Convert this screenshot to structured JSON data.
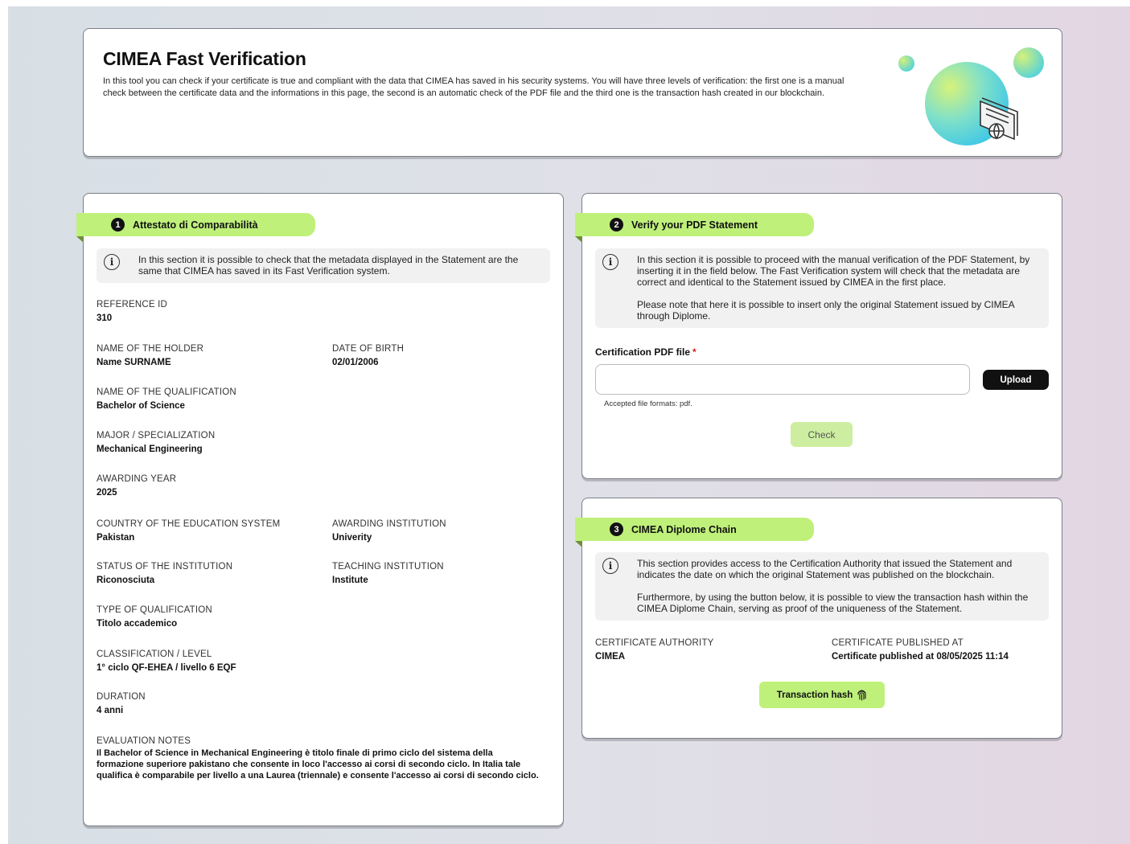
{
  "header": {
    "title": "CIMEA Fast Verification",
    "description": "In this tool you can check if your certificate is true and compliant with the data that CIMEA has saved in his security systems. You will have three levels of verification: the first one is a manual check between the certificate data and the informations in this page, the second is an automatic check of the PDF file and the third one is the transaction hash created in our blockchain."
  },
  "section1": {
    "number": "1",
    "title": "Attestato di Comparabilità",
    "info": "In this section it is possible to check that the metadata displayed in the Statement are the same that CIMEA has saved in its Fast Verification system.",
    "fields": {
      "reference_id": {
        "label": "REFERENCE ID",
        "value": "310"
      },
      "holder": {
        "label": "NAME OF THE HOLDER",
        "value": "Name SURNAME"
      },
      "dob": {
        "label": "DATE OF BIRTH",
        "value": "02/01/2006"
      },
      "qualification": {
        "label": "NAME OF THE QUALIFICATION",
        "value": "Bachelor of Science"
      },
      "major": {
        "label": "MAJOR / SPECIALIZATION",
        "value": "Mechanical Engineering"
      },
      "year": {
        "label": "AWARDING YEAR",
        "value": "2025"
      },
      "country": {
        "label": "COUNTRY OF THE EDUCATION SYSTEM",
        "value": "Pakistan"
      },
      "awarding": {
        "label": "AWARDING INSTITUTION",
        "value": "Univerity"
      },
      "status": {
        "label": "STATUS OF THE INSTITUTION",
        "value": "Riconosciuta"
      },
      "teaching": {
        "label": "TEACHING INSTITUTION",
        "value": "Institute"
      },
      "type": {
        "label": "TYPE OF QUALIFICATION",
        "value": "Titolo accademico"
      },
      "classification": {
        "label": "CLASSIFICATION / LEVEL",
        "value": "1° ciclo QF-EHEA / livello 6 EQF"
      },
      "duration": {
        "label": "DURATION",
        "value": "4 anni"
      },
      "notes": {
        "label": "EVALUATION NOTES",
        "value": "Il Bachelor of Science in Mechanical Engineering è titolo finale di primo ciclo del sistema della formazione superiore pakistano che consente in loco l'accesso ai corsi di secondo ciclo. In Italia tale qualifica è comparabile per livello a una Laurea (triennale) e consente l'accesso ai corsi di secondo ciclo."
      }
    }
  },
  "section2": {
    "number": "2",
    "title": "Verify your PDF Statement",
    "info_p1": "In this section it is possible to proceed with the manual verification of the PDF Statement, by inserting it in the field below. The Fast Verification system will check that the metadata are correct and identical to the Statement issued by CIMEA in the first place.",
    "info_p2": "Please note that here it is possible to insert only the original Statement issued by CIMEA through Diplome.",
    "file_label": "Certification PDF file",
    "required_mark": "*",
    "upload_label": "Upload",
    "formats": "Accepted file formats: pdf.",
    "check_label": "Check"
  },
  "section3": {
    "number": "3",
    "title": "CIMEA Diplome Chain",
    "info_p1": "This section provides access to the Certification Authority that issued the Statement and indicates the date on which the original Statement was published on the blockchain.",
    "info_p2": "Furthermore, by using the button below, it is possible to view the transaction hash within the CIMEA Diplome Chain, serving as proof of the uniqueness of the Statement.",
    "authority": {
      "label": "CERTIFICATE AUTHORITY",
      "value": "CIMEA"
    },
    "published": {
      "label": "CERTIFICATE PUBLISHED AT",
      "value": "Certificate published at 08/05/2025 11:14"
    },
    "hash_label": "Transaction hash"
  }
}
